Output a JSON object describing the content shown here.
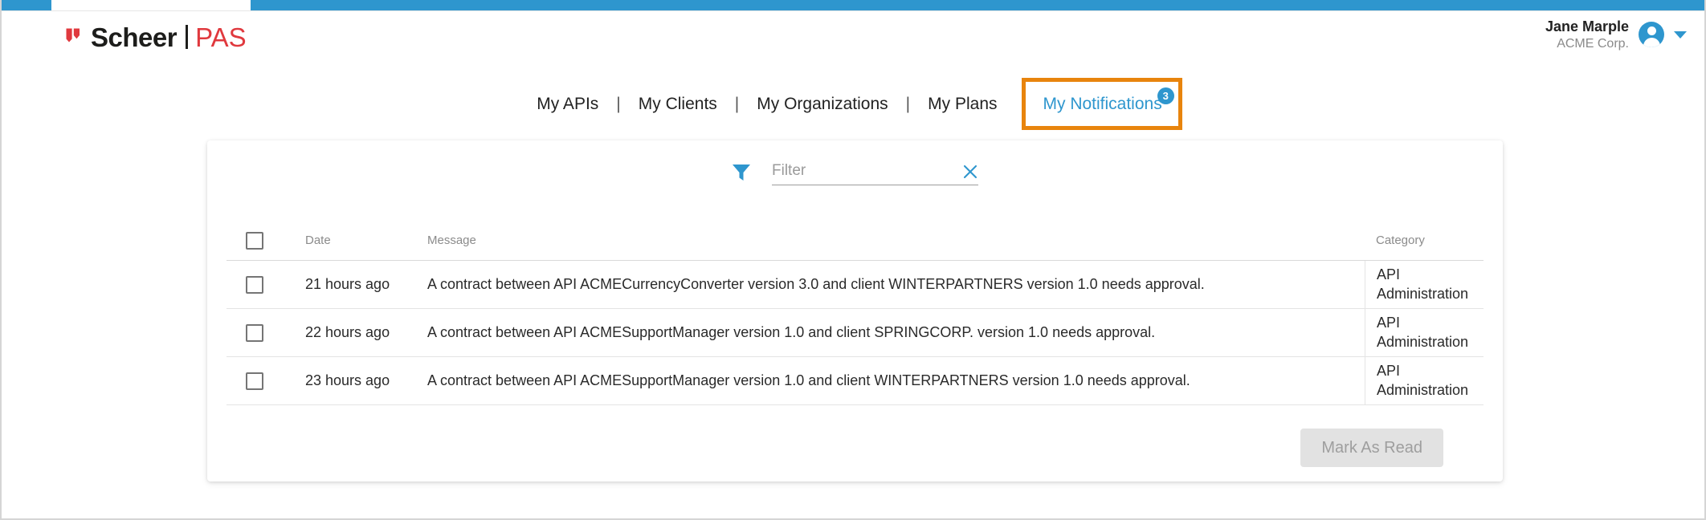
{
  "brand": {
    "logo_mark_icon": "scheer-w-mark-icon",
    "name_primary": "Scheer",
    "name_secondary": "PAS",
    "color_red": "#e0393e",
    "color_blue": "#2e96ce",
    "color_black": "#1d1d1b"
  },
  "header": {
    "user_name": "Jane Marple",
    "user_org": "ACME Corp.",
    "avatar_icon": "user-avatar-icon",
    "caret_icon": "chevron-down-icon"
  },
  "nav": {
    "separator": "|",
    "items": [
      {
        "label": "My APIs"
      },
      {
        "label": "My Clients"
      },
      {
        "label": "My Organizations"
      },
      {
        "label": "My Plans"
      }
    ],
    "active_item": {
      "label": "My Notifications",
      "badge_count": "3",
      "highlight_color": "#e8840d",
      "label_color": "#2e96ce",
      "badge_color": "#2e96ce"
    }
  },
  "filter": {
    "funnel_icon": "filter-funnel-icon",
    "placeholder": "Filter",
    "value": "",
    "clear_icon": "close-x-icon"
  },
  "table": {
    "columns": [
      {
        "key": "select",
        "label": ""
      },
      {
        "key": "date",
        "label": "Date"
      },
      {
        "key": "message",
        "label": "Message"
      },
      {
        "key": "category",
        "label": "Category"
      }
    ],
    "select_all_checked": false,
    "rows": [
      {
        "checked": false,
        "date": "21 hours ago",
        "message": "A contract between API ACMECurrencyConverter version 3.0 and client WINTERPARTNERS version 1.0 needs approval.",
        "category": "API Administration"
      },
      {
        "checked": false,
        "date": "22 hours ago",
        "message": "A contract between API ACMESupportManager version 1.0 and client SPRINGCORP. version 1.0 needs approval.",
        "category": "API Administration"
      },
      {
        "checked": false,
        "date": "23 hours ago",
        "message": "A contract between API ACMESupportManager version 1.0 and client WINTERPARTNERS version 1.0 needs approval.",
        "category": "API Administration"
      }
    ]
  },
  "footer": {
    "mark_as_read_label": "Mark As Read",
    "mark_as_read_disabled": true
  }
}
